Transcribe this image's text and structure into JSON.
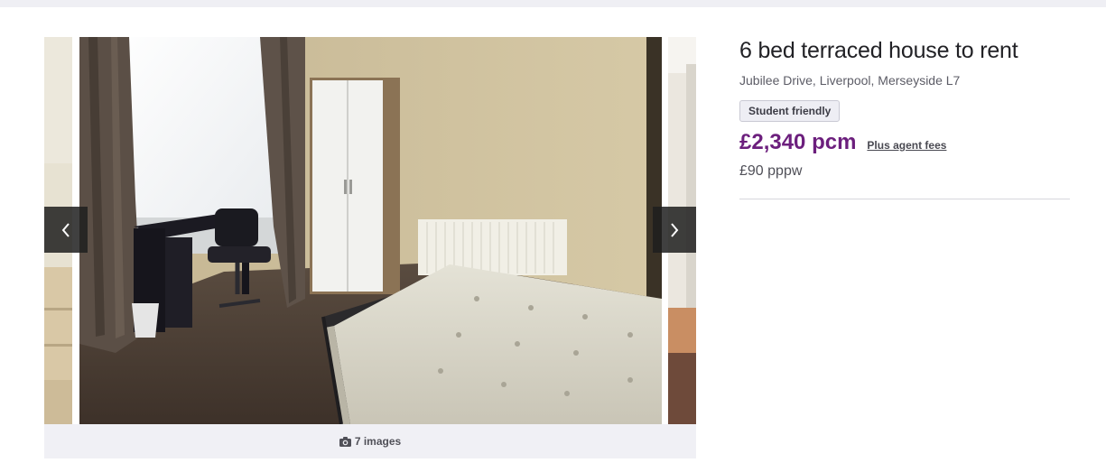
{
  "listing": {
    "title": "6 bed terraced house to rent",
    "address": "Jubilee Drive, Liverpool, Merseyside L7",
    "badge": "Student friendly",
    "price": "£2,340 pcm",
    "fees_link": "Plus agent fees",
    "price_per_person": "£90 pppw"
  },
  "gallery": {
    "image_count_label": "7 images",
    "count_icon": "camera-icon",
    "prev_icon": "chevron-left-icon",
    "next_icon": "chevron-right-icon"
  },
  "colors": {
    "price": "#6c1f7d",
    "nav_background": "#1e1e1e",
    "caption_bar": "#f0f0f5"
  }
}
